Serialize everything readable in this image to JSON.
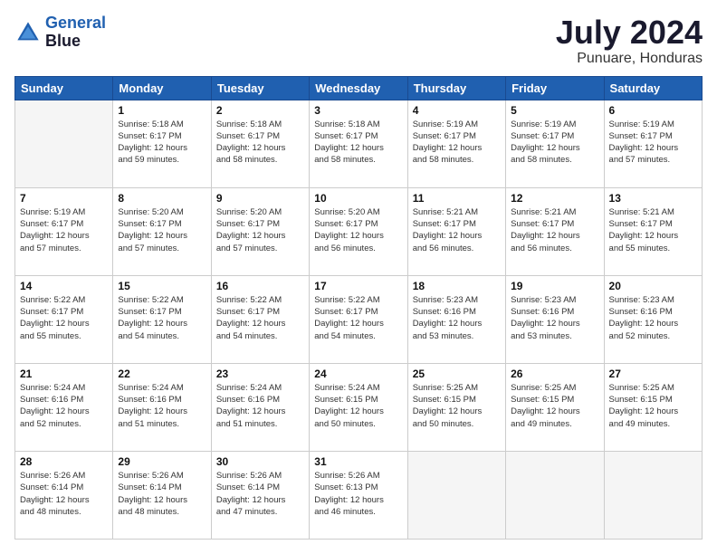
{
  "logo": {
    "line1": "General",
    "line2": "Blue"
  },
  "title": "July 2024",
  "location": "Punuare, Honduras",
  "days_header": [
    "Sunday",
    "Monday",
    "Tuesday",
    "Wednesday",
    "Thursday",
    "Friday",
    "Saturday"
  ],
  "weeks": [
    [
      {
        "day": "",
        "info": ""
      },
      {
        "day": "1",
        "info": "Sunrise: 5:18 AM\nSunset: 6:17 PM\nDaylight: 12 hours\nand 59 minutes."
      },
      {
        "day": "2",
        "info": "Sunrise: 5:18 AM\nSunset: 6:17 PM\nDaylight: 12 hours\nand 58 minutes."
      },
      {
        "day": "3",
        "info": "Sunrise: 5:18 AM\nSunset: 6:17 PM\nDaylight: 12 hours\nand 58 minutes."
      },
      {
        "day": "4",
        "info": "Sunrise: 5:19 AM\nSunset: 6:17 PM\nDaylight: 12 hours\nand 58 minutes."
      },
      {
        "day": "5",
        "info": "Sunrise: 5:19 AM\nSunset: 6:17 PM\nDaylight: 12 hours\nand 58 minutes."
      },
      {
        "day": "6",
        "info": "Sunrise: 5:19 AM\nSunset: 6:17 PM\nDaylight: 12 hours\nand 57 minutes."
      }
    ],
    [
      {
        "day": "7",
        "info": "Sunrise: 5:19 AM\nSunset: 6:17 PM\nDaylight: 12 hours\nand 57 minutes."
      },
      {
        "day": "8",
        "info": "Sunrise: 5:20 AM\nSunset: 6:17 PM\nDaylight: 12 hours\nand 57 minutes."
      },
      {
        "day": "9",
        "info": "Sunrise: 5:20 AM\nSunset: 6:17 PM\nDaylight: 12 hours\nand 57 minutes."
      },
      {
        "day": "10",
        "info": "Sunrise: 5:20 AM\nSunset: 6:17 PM\nDaylight: 12 hours\nand 56 minutes."
      },
      {
        "day": "11",
        "info": "Sunrise: 5:21 AM\nSunset: 6:17 PM\nDaylight: 12 hours\nand 56 minutes."
      },
      {
        "day": "12",
        "info": "Sunrise: 5:21 AM\nSunset: 6:17 PM\nDaylight: 12 hours\nand 56 minutes."
      },
      {
        "day": "13",
        "info": "Sunrise: 5:21 AM\nSunset: 6:17 PM\nDaylight: 12 hours\nand 55 minutes."
      }
    ],
    [
      {
        "day": "14",
        "info": "Sunrise: 5:22 AM\nSunset: 6:17 PM\nDaylight: 12 hours\nand 55 minutes."
      },
      {
        "day": "15",
        "info": "Sunrise: 5:22 AM\nSunset: 6:17 PM\nDaylight: 12 hours\nand 54 minutes."
      },
      {
        "day": "16",
        "info": "Sunrise: 5:22 AM\nSunset: 6:17 PM\nDaylight: 12 hours\nand 54 minutes."
      },
      {
        "day": "17",
        "info": "Sunrise: 5:22 AM\nSunset: 6:17 PM\nDaylight: 12 hours\nand 54 minutes."
      },
      {
        "day": "18",
        "info": "Sunrise: 5:23 AM\nSunset: 6:16 PM\nDaylight: 12 hours\nand 53 minutes."
      },
      {
        "day": "19",
        "info": "Sunrise: 5:23 AM\nSunset: 6:16 PM\nDaylight: 12 hours\nand 53 minutes."
      },
      {
        "day": "20",
        "info": "Sunrise: 5:23 AM\nSunset: 6:16 PM\nDaylight: 12 hours\nand 52 minutes."
      }
    ],
    [
      {
        "day": "21",
        "info": "Sunrise: 5:24 AM\nSunset: 6:16 PM\nDaylight: 12 hours\nand 52 minutes."
      },
      {
        "day": "22",
        "info": "Sunrise: 5:24 AM\nSunset: 6:16 PM\nDaylight: 12 hours\nand 51 minutes."
      },
      {
        "day": "23",
        "info": "Sunrise: 5:24 AM\nSunset: 6:16 PM\nDaylight: 12 hours\nand 51 minutes."
      },
      {
        "day": "24",
        "info": "Sunrise: 5:24 AM\nSunset: 6:15 PM\nDaylight: 12 hours\nand 50 minutes."
      },
      {
        "day": "25",
        "info": "Sunrise: 5:25 AM\nSunset: 6:15 PM\nDaylight: 12 hours\nand 50 minutes."
      },
      {
        "day": "26",
        "info": "Sunrise: 5:25 AM\nSunset: 6:15 PM\nDaylight: 12 hours\nand 49 minutes."
      },
      {
        "day": "27",
        "info": "Sunrise: 5:25 AM\nSunset: 6:15 PM\nDaylight: 12 hours\nand 49 minutes."
      }
    ],
    [
      {
        "day": "28",
        "info": "Sunrise: 5:26 AM\nSunset: 6:14 PM\nDaylight: 12 hours\nand 48 minutes."
      },
      {
        "day": "29",
        "info": "Sunrise: 5:26 AM\nSunset: 6:14 PM\nDaylight: 12 hours\nand 48 minutes."
      },
      {
        "day": "30",
        "info": "Sunrise: 5:26 AM\nSunset: 6:14 PM\nDaylight: 12 hours\nand 47 minutes."
      },
      {
        "day": "31",
        "info": "Sunrise: 5:26 AM\nSunset: 6:13 PM\nDaylight: 12 hours\nand 46 minutes."
      },
      {
        "day": "",
        "info": ""
      },
      {
        "day": "",
        "info": ""
      },
      {
        "day": "",
        "info": ""
      }
    ]
  ]
}
